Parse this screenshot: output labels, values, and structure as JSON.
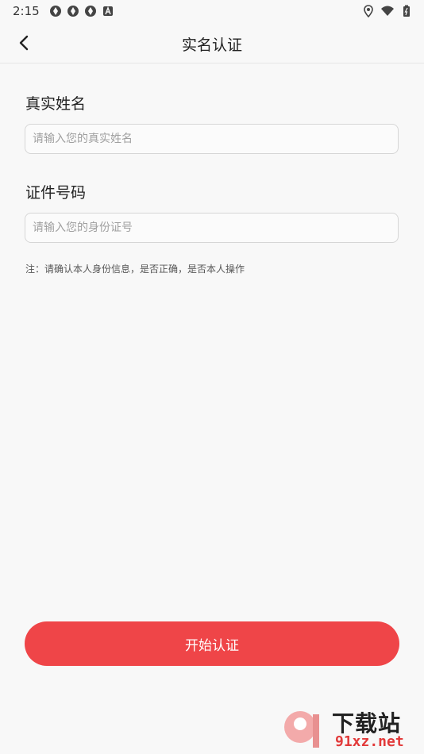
{
  "status_bar": {
    "time": "2:15",
    "icons": [
      "notification-icon",
      "notification-icon",
      "notification-icon",
      "a-icon"
    ],
    "right_icons": [
      "location-icon",
      "wifi-icon",
      "battery-icon"
    ]
  },
  "header": {
    "title": "实名认证",
    "back_icon": "chevron-left-icon"
  },
  "form": {
    "name_label": "真实姓名",
    "name_placeholder": "请输入您的真实姓名",
    "name_value": "",
    "id_label": "证件号码",
    "id_placeholder": "请输入您的身份证号",
    "id_value": "",
    "note": "注：请确认本人身份信息，是否正确，是否本人操作"
  },
  "actions": {
    "submit_label": "开始认证"
  },
  "watermark": {
    "line1": "下载站",
    "line2": "91xz.net"
  },
  "colors": {
    "accent": "#ef4548",
    "background": "#f8f8f8"
  }
}
